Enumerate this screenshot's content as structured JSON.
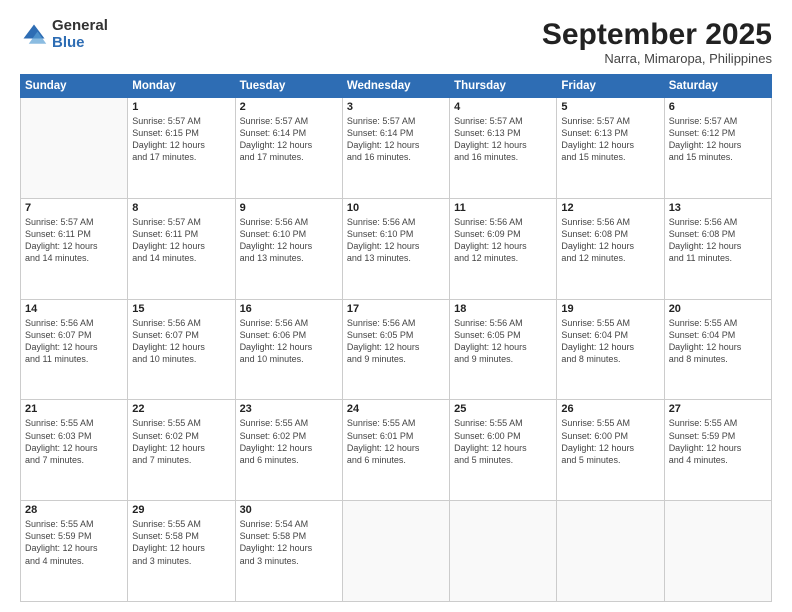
{
  "logo": {
    "general": "General",
    "blue": "Blue"
  },
  "header": {
    "month": "September 2025",
    "location": "Narra, Mimaropa, Philippines"
  },
  "weekdays": [
    "Sunday",
    "Monday",
    "Tuesday",
    "Wednesday",
    "Thursday",
    "Friday",
    "Saturday"
  ],
  "weeks": [
    [
      {
        "day": "",
        "info": ""
      },
      {
        "day": "1",
        "info": "Sunrise: 5:57 AM\nSunset: 6:15 PM\nDaylight: 12 hours\nand 17 minutes."
      },
      {
        "day": "2",
        "info": "Sunrise: 5:57 AM\nSunset: 6:14 PM\nDaylight: 12 hours\nand 17 minutes."
      },
      {
        "day": "3",
        "info": "Sunrise: 5:57 AM\nSunset: 6:14 PM\nDaylight: 12 hours\nand 16 minutes."
      },
      {
        "day": "4",
        "info": "Sunrise: 5:57 AM\nSunset: 6:13 PM\nDaylight: 12 hours\nand 16 minutes."
      },
      {
        "day": "5",
        "info": "Sunrise: 5:57 AM\nSunset: 6:13 PM\nDaylight: 12 hours\nand 15 minutes."
      },
      {
        "day": "6",
        "info": "Sunrise: 5:57 AM\nSunset: 6:12 PM\nDaylight: 12 hours\nand 15 minutes."
      }
    ],
    [
      {
        "day": "7",
        "info": "Sunrise: 5:57 AM\nSunset: 6:11 PM\nDaylight: 12 hours\nand 14 minutes."
      },
      {
        "day": "8",
        "info": "Sunrise: 5:57 AM\nSunset: 6:11 PM\nDaylight: 12 hours\nand 14 minutes."
      },
      {
        "day": "9",
        "info": "Sunrise: 5:56 AM\nSunset: 6:10 PM\nDaylight: 12 hours\nand 13 minutes."
      },
      {
        "day": "10",
        "info": "Sunrise: 5:56 AM\nSunset: 6:10 PM\nDaylight: 12 hours\nand 13 minutes."
      },
      {
        "day": "11",
        "info": "Sunrise: 5:56 AM\nSunset: 6:09 PM\nDaylight: 12 hours\nand 12 minutes."
      },
      {
        "day": "12",
        "info": "Sunrise: 5:56 AM\nSunset: 6:08 PM\nDaylight: 12 hours\nand 12 minutes."
      },
      {
        "day": "13",
        "info": "Sunrise: 5:56 AM\nSunset: 6:08 PM\nDaylight: 12 hours\nand 11 minutes."
      }
    ],
    [
      {
        "day": "14",
        "info": "Sunrise: 5:56 AM\nSunset: 6:07 PM\nDaylight: 12 hours\nand 11 minutes."
      },
      {
        "day": "15",
        "info": "Sunrise: 5:56 AM\nSunset: 6:07 PM\nDaylight: 12 hours\nand 10 minutes."
      },
      {
        "day": "16",
        "info": "Sunrise: 5:56 AM\nSunset: 6:06 PM\nDaylight: 12 hours\nand 10 minutes."
      },
      {
        "day": "17",
        "info": "Sunrise: 5:56 AM\nSunset: 6:05 PM\nDaylight: 12 hours\nand 9 minutes."
      },
      {
        "day": "18",
        "info": "Sunrise: 5:56 AM\nSunset: 6:05 PM\nDaylight: 12 hours\nand 9 minutes."
      },
      {
        "day": "19",
        "info": "Sunrise: 5:55 AM\nSunset: 6:04 PM\nDaylight: 12 hours\nand 8 minutes."
      },
      {
        "day": "20",
        "info": "Sunrise: 5:55 AM\nSunset: 6:04 PM\nDaylight: 12 hours\nand 8 minutes."
      }
    ],
    [
      {
        "day": "21",
        "info": "Sunrise: 5:55 AM\nSunset: 6:03 PM\nDaylight: 12 hours\nand 7 minutes."
      },
      {
        "day": "22",
        "info": "Sunrise: 5:55 AM\nSunset: 6:02 PM\nDaylight: 12 hours\nand 7 minutes."
      },
      {
        "day": "23",
        "info": "Sunrise: 5:55 AM\nSunset: 6:02 PM\nDaylight: 12 hours\nand 6 minutes."
      },
      {
        "day": "24",
        "info": "Sunrise: 5:55 AM\nSunset: 6:01 PM\nDaylight: 12 hours\nand 6 minutes."
      },
      {
        "day": "25",
        "info": "Sunrise: 5:55 AM\nSunset: 6:00 PM\nDaylight: 12 hours\nand 5 minutes."
      },
      {
        "day": "26",
        "info": "Sunrise: 5:55 AM\nSunset: 6:00 PM\nDaylight: 12 hours\nand 5 minutes."
      },
      {
        "day": "27",
        "info": "Sunrise: 5:55 AM\nSunset: 5:59 PM\nDaylight: 12 hours\nand 4 minutes."
      }
    ],
    [
      {
        "day": "28",
        "info": "Sunrise: 5:55 AM\nSunset: 5:59 PM\nDaylight: 12 hours\nand 4 minutes."
      },
      {
        "day": "29",
        "info": "Sunrise: 5:55 AM\nSunset: 5:58 PM\nDaylight: 12 hours\nand 3 minutes."
      },
      {
        "day": "30",
        "info": "Sunrise: 5:54 AM\nSunset: 5:58 PM\nDaylight: 12 hours\nand 3 minutes."
      },
      {
        "day": "",
        "info": ""
      },
      {
        "day": "",
        "info": ""
      },
      {
        "day": "",
        "info": ""
      },
      {
        "day": "",
        "info": ""
      }
    ]
  ]
}
